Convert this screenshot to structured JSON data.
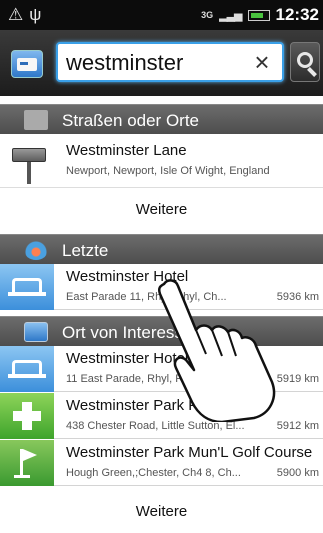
{
  "status_bar": {
    "left_icons": [
      "warning-icon",
      "usb-icon"
    ],
    "network": "3G",
    "time": "12:32"
  },
  "search": {
    "value": "westminster",
    "clear_label": "×"
  },
  "sections": {
    "streets": {
      "title": "Straßen oder Orte",
      "items": [
        {
          "name": "Westminster Lane",
          "address": "Newport, Newport, Isle Of Wight, England"
        }
      ],
      "more": "Weitere"
    },
    "recent": {
      "title": "Letzte",
      "items": [
        {
          "name": "Westminster Hotel",
          "address": "East Parade 11, Rhyl, Rhyl, Ch...",
          "distance": "5936 km",
          "icon": "hotel-icon"
        }
      ]
    },
    "poi": {
      "title": "Ort von Interesse",
      "items": [
        {
          "name": "Westminster Hotel",
          "address": "11 East Parade, Rhyl, Rhyl, Ch...",
          "distance": "5919 km",
          "icon": "hotel-icon"
        },
        {
          "name": "Westminster Park Pharmacy",
          "address": "438 Chester Road, Little Sutton, El...",
          "distance": "5912 km",
          "icon": "pharmacy-icon"
        },
        {
          "name": "Westminster Park Mun'L Golf Course",
          "address": "Hough Green,;Chester, Ch4 8, Ch...",
          "distance": "5900 km",
          "icon": "golf-icon"
        }
      ],
      "more": "Weitere"
    }
  },
  "colors": {
    "search_focus": "#3aa0e8",
    "section_header": "#5a5a5a"
  }
}
